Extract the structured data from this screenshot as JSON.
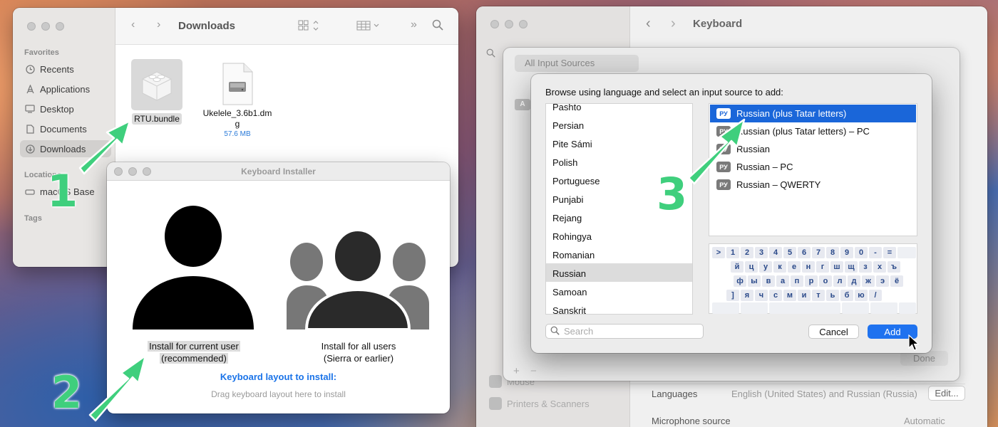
{
  "finder": {
    "title": "Downloads",
    "sidebar": {
      "favorites_heading": "Favorites",
      "items": [
        {
          "label": "Recents",
          "icon": "clock-icon"
        },
        {
          "label": "Applications",
          "icon": "applications-icon"
        },
        {
          "label": "Desktop",
          "icon": "desktop-icon"
        },
        {
          "label": "Documents",
          "icon": "document-icon"
        },
        {
          "label": "Downloads",
          "icon": "download-icon"
        }
      ],
      "locations_heading": "Locations",
      "location_item": "macOS Base",
      "tags_heading": "Tags"
    },
    "files": [
      {
        "name": "RTU.bundle",
        "icon": "bundle-lego-icon"
      },
      {
        "name_line1": "Ukelele_3.6b1.dm",
        "name_line2": "g",
        "size": "57.6 MB",
        "icon": "disk-image-icon"
      }
    ]
  },
  "installer": {
    "title": "Keyboard Installer",
    "option_user_line1": "Install for current user",
    "option_user_line2": "(recommended)",
    "option_all_line1": "Install for all users",
    "option_all_line2": "(Sierra or earlier)",
    "layout_heading": "Keyboard layout to install:",
    "drag_hint": "Drag keyboard layout here to install"
  },
  "settings": {
    "title": "Keyboard",
    "sheet_source_item": "All Input Sources",
    "sheet_done": "Done",
    "sidebar_items": [
      "Mouse",
      "Printers & Scanners"
    ],
    "languages_label": "Languages",
    "languages_value": "English (United States) and Russian (Russia)",
    "edit_button": "Edit...",
    "microphone_label": "Microphone source",
    "microphone_value": "Automatic"
  },
  "browse": {
    "instruction": "Browse using language and select an input source to add:",
    "languages": [
      "Pashto",
      "Persian",
      "Pite Sámi",
      "Polish",
      "Portuguese",
      "Punjabi",
      "Rejang",
      "Rohingya",
      "Romanian",
      "Russian",
      "Samoan",
      "Sanskrit"
    ],
    "selected_language": "Russian",
    "sources": [
      {
        "label": "Russian (plus Tatar letters)",
        "badge": "РУ",
        "selected": true
      },
      {
        "label": "Russian (plus Tatar letters) – PC",
        "badge": "РУ",
        "selected": false
      },
      {
        "label": "Russian",
        "badge": "РУ",
        "selected": false
      },
      {
        "label": "Russian – PC",
        "badge": "РУ",
        "selected": false
      },
      {
        "label": "Russian – QWERTY",
        "badge": "РУ",
        "selected": false
      }
    ],
    "keyboard_rows": [
      [
        ">",
        "1",
        "2",
        "3",
        "4",
        "5",
        "6",
        "7",
        "8",
        "9",
        "0",
        "-",
        "="
      ],
      [
        "й",
        "ц",
        "у",
        "к",
        "е",
        "н",
        "г",
        "ш",
        "щ",
        "з",
        "х",
        "ъ"
      ],
      [
        "ф",
        "ы",
        "в",
        "а",
        "п",
        "р",
        "о",
        "л",
        "д",
        "ж",
        "э",
        "ё"
      ],
      [
        "]",
        "я",
        "ч",
        "с",
        "м",
        "и",
        "т",
        "ь",
        "б",
        "ю",
        "/"
      ]
    ],
    "search_placeholder": "Search",
    "cancel_label": "Cancel",
    "add_label": "Add"
  },
  "annotations": {
    "step1": "1",
    "step2": "2",
    "step3": "3",
    "arrow_color": "#3fcf7d"
  }
}
